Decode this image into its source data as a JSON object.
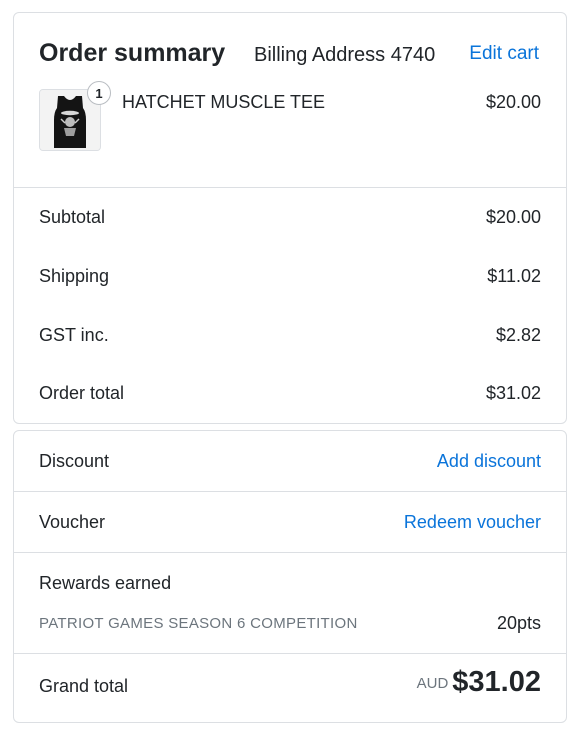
{
  "summary": {
    "title": "Order summary",
    "subtitle": "Billing Address 4740",
    "edit_cart": "Edit cart"
  },
  "item": {
    "quantity": "1",
    "name": "HATCHET MUSCLE TEE",
    "price": "$20.00",
    "thumbnail_icon": "black-tank-top-image"
  },
  "totals": {
    "subtotal_label": "Subtotal",
    "subtotal_value": "$20.00",
    "shipping_label": "Shipping",
    "shipping_value": "$11.02",
    "gst_label": "GST inc.",
    "gst_value": "$2.82",
    "order_total_label": "Order total",
    "order_total_value": "$31.02"
  },
  "discount": {
    "label": "Discount",
    "action": "Add discount"
  },
  "voucher": {
    "label": "Voucher",
    "action": "Redeem voucher"
  },
  "rewards": {
    "label": "Rewards earned",
    "program": "PATRIOT GAMES SEASON 6 COMPETITION",
    "points": "20pts"
  },
  "grand_total": {
    "label": "Grand total",
    "currency": "AUD",
    "amount": "$31.02"
  },
  "colors": {
    "link": "#0a74da",
    "text": "#212529",
    "muted": "#6c757d",
    "border": "#dcdfe3"
  }
}
